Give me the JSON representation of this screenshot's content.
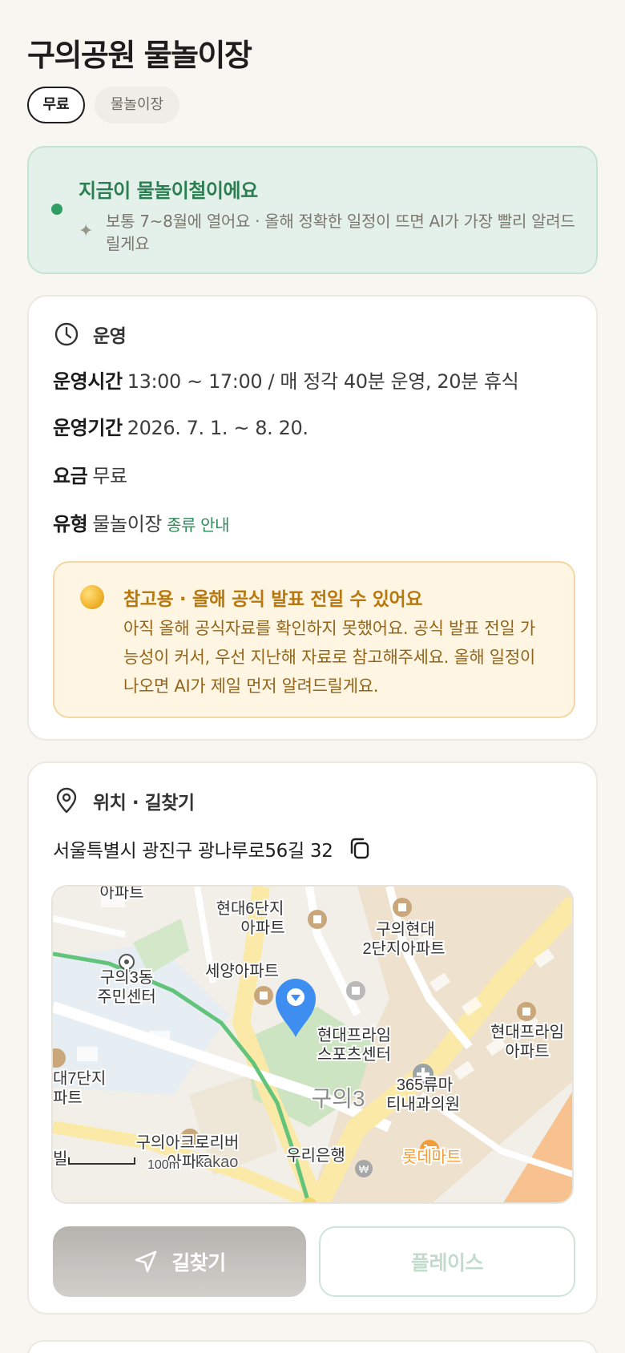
{
  "title": "구의공원 물놀이장",
  "chips": {
    "free": "무료",
    "category": "물놀이장"
  },
  "season": {
    "headline": "지금이 물놀이철이에요",
    "sub": "보통 7~8월에 열어요 · 올해 정확한 일정이 뜨면 AI가 가장 빨리 알려드릴게요"
  },
  "operation": {
    "section_label": "운영",
    "hours_key": "운영시간",
    "hours_value": "13:00 ~ 17:00 / 매 정각 40분 운영, 20분 휴식",
    "period_key": "운영기간",
    "period_value": "2026. 7. 1. ~ 8. 20.",
    "fee_key": "요금",
    "fee_value": "무료",
    "type_key": "유형",
    "type_value": "물놀이장",
    "type_link": "종류 안내"
  },
  "notice": {
    "title": "참고용 · 올해 공식 발표 전일 수 있어요",
    "body": "아직 올해 공식자료를 확인하지 못했어요. 공식 발표 전일 가능성이 커서, 우선 지난해 자료로 참고해주세요. 올해 일정이 나오면 AI가 제일 먼저 알려드릴게요."
  },
  "location": {
    "section_label": "위치 · 길찾기",
    "address": "서울특별시 광진구 광나루로56길 32"
  },
  "map": {
    "labels": {
      "apt_top": "아파트",
      "hyundai6_1": "현대6단지",
      "hyundai6_2": "아파트",
      "guui_hyundai2_1": "구의현대",
      "guui_hyundai2_2": "2단지아파트",
      "center_1": "구의3동",
      "center_2": "주민센터",
      "seyang": "세양아파트",
      "prime_sports_1": "현대프라임",
      "prime_sports_2": "스포츠센터",
      "prime_apt_1": "현대프라임",
      "prime_apt_2": "아파트",
      "dae7_1": "대7단지",
      "dae7_2": "파트",
      "clinic_1": "365류마",
      "clinic_2": "티내과의원",
      "guui_area": "구의3",
      "acro_1": "구의아크로리버",
      "acro_2": "아파트",
      "bank": "우리은행",
      "lotte": "롯데마트",
      "scale": "100m",
      "brand": "kakao",
      "edge_left": "빌"
    },
    "colors": {
      "pin": "#3d8ef0",
      "route": "#62c37b",
      "lotte": "#f29d38"
    }
  },
  "buttons": {
    "route": "길찾기",
    "place": "플레이스"
  }
}
